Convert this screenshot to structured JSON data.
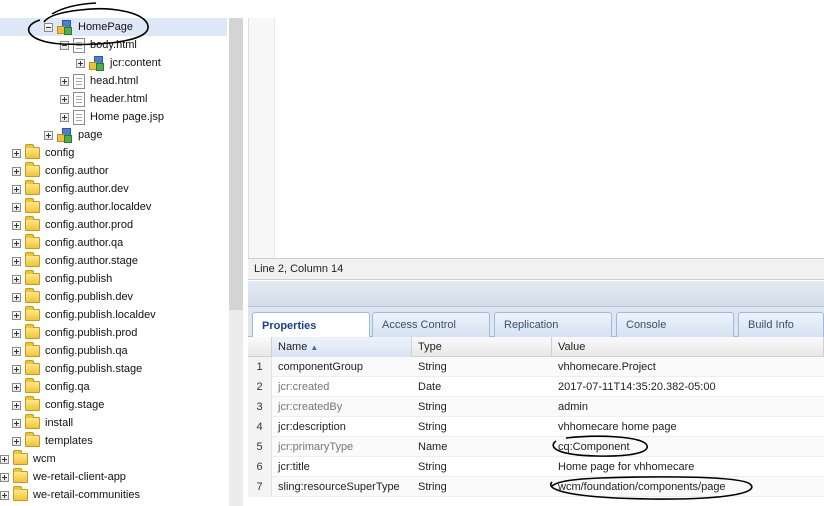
{
  "tree": {
    "nodes": [
      {
        "label": "HomePage",
        "icon": "component-node-icon",
        "expander": "minus",
        "selected": true
      },
      {
        "label": "body.html",
        "icon": "file-icon",
        "expander": "minus"
      },
      {
        "label": "jcr:content",
        "icon": "component-node-icon",
        "expander": "plus"
      },
      {
        "label": "head.html",
        "icon": "file-icon",
        "expander": "plus"
      },
      {
        "label": "header.html",
        "icon": "file-icon",
        "expander": "plus"
      },
      {
        "label": "Home page.jsp",
        "icon": "file-icon",
        "expander": "plus"
      },
      {
        "label": "page",
        "icon": "component-node-icon",
        "expander": "plus"
      },
      {
        "label": "config",
        "icon": "folder-icon",
        "expander": "plus"
      },
      {
        "label": "config.author",
        "icon": "folder-icon",
        "expander": "plus"
      },
      {
        "label": "config.author.dev",
        "icon": "folder-icon",
        "expander": "plus"
      },
      {
        "label": "config.author.localdev",
        "icon": "folder-icon",
        "expander": "plus"
      },
      {
        "label": "config.author.prod",
        "icon": "folder-icon",
        "expander": "plus"
      },
      {
        "label": "config.author.qa",
        "icon": "folder-icon",
        "expander": "plus"
      },
      {
        "label": "config.author.stage",
        "icon": "folder-icon",
        "expander": "plus"
      },
      {
        "label": "config.publish",
        "icon": "folder-icon",
        "expander": "plus"
      },
      {
        "label": "config.publish.dev",
        "icon": "folder-icon",
        "expander": "plus"
      },
      {
        "label": "config.publish.localdev",
        "icon": "folder-icon",
        "expander": "plus"
      },
      {
        "label": "config.publish.prod",
        "icon": "folder-icon",
        "expander": "plus"
      },
      {
        "label": "config.publish.qa",
        "icon": "folder-icon",
        "expander": "plus"
      },
      {
        "label": "config.publish.stage",
        "icon": "folder-icon",
        "expander": "plus"
      },
      {
        "label": "config.qa",
        "icon": "folder-icon",
        "expander": "plus"
      },
      {
        "label": "config.stage",
        "icon": "folder-icon",
        "expander": "plus"
      },
      {
        "label": "install",
        "icon": "folder-icon",
        "expander": "plus"
      },
      {
        "label": "templates",
        "icon": "folder-icon",
        "expander": "plus"
      },
      {
        "label": "wcm",
        "icon": "folder-icon",
        "expander": "plus"
      },
      {
        "label": "we-retail-client-app",
        "icon": "folder-icon",
        "expander": "plus"
      },
      {
        "label": "we-retail-communities",
        "icon": "folder-icon",
        "expander": "plus"
      }
    ]
  },
  "editor": {
    "status": "Line 2, Column 14"
  },
  "tabs": [
    {
      "label": "Properties",
      "active": true
    },
    {
      "label": "Access Control"
    },
    {
      "label": "Replication"
    },
    {
      "label": "Console"
    },
    {
      "label": "Build Info"
    }
  ],
  "grid": {
    "columns": [
      {
        "label": "Name",
        "sorted": "asc"
      },
      {
        "label": "Type"
      },
      {
        "label": "Value"
      }
    ],
    "rows": [
      {
        "num": "1",
        "name": "componentGroup",
        "type": "String",
        "value": "vhhomecare.Project"
      },
      {
        "num": "2",
        "name": "jcr:created",
        "type": "Date",
        "value": "2017-07-11T14:35:20.382-05:00",
        "muted": true
      },
      {
        "num": "3",
        "name": "jcr:createdBy",
        "type": "String",
        "value": "admin",
        "muted": true
      },
      {
        "num": "4",
        "name": "jcr:description",
        "type": "String",
        "value": "vhhomecare home page"
      },
      {
        "num": "5",
        "name": "jcr:primaryType",
        "type": "Name",
        "value": "cq:Component",
        "muted": true
      },
      {
        "num": "6",
        "name": "jcr:title",
        "type": "String",
        "value": "Home page for vhhomecare"
      },
      {
        "num": "7",
        "name": "sling:resourceSuperType",
        "type": "String",
        "value": "wcm/foundation/components/page"
      }
    ]
  },
  "colors": {
    "selection": "#dfe8f6",
    "tab_border": "#99bbe8",
    "annotation_ink": "#000000"
  }
}
